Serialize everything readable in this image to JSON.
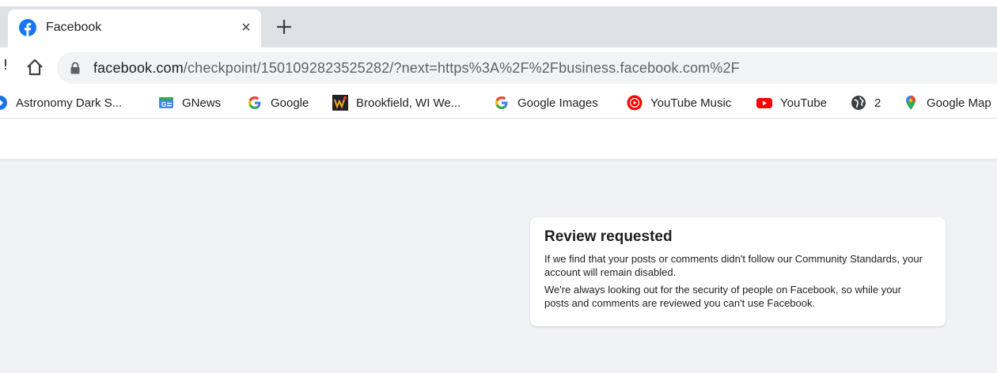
{
  "browser": {
    "tab": {
      "title": "Facebook"
    },
    "address": {
      "domain": "facebook.com",
      "path": "/checkpoint/1501092823525282/?next=https%3A%2F%2Fbusiness.facebook.com%2F"
    },
    "bookmarks": [
      {
        "label": "Astronomy Dark S...",
        "icon": "astronomy-icon"
      },
      {
        "label": "GNews",
        "icon": "gnews-icon"
      },
      {
        "label": "Google",
        "icon": "google-icon"
      },
      {
        "label": "Brookfield, WI We...",
        "icon": "weather-icon"
      },
      {
        "label": "Google Images",
        "icon": "google-icon"
      },
      {
        "label": "YouTube Music",
        "icon": "youtube-music-icon"
      },
      {
        "label": "YouTube",
        "icon": "youtube-icon"
      },
      {
        "label": "2",
        "icon": "globe-icon"
      },
      {
        "label": "Google Map",
        "icon": "google-maps-icon"
      }
    ]
  },
  "card": {
    "title": "Review requested",
    "paragraph1": "If we find that your posts or comments didn't follow our Community Standards, your account will remain disabled.",
    "paragraph2": "We're always looking out for the security of people on Facebook, so while your posts and comments are reviewed you can't use Facebook."
  },
  "colors": {
    "facebook_blue": "#1877f2",
    "page_background": "#f0f2f5",
    "tabstrip": "#dee1e6"
  }
}
